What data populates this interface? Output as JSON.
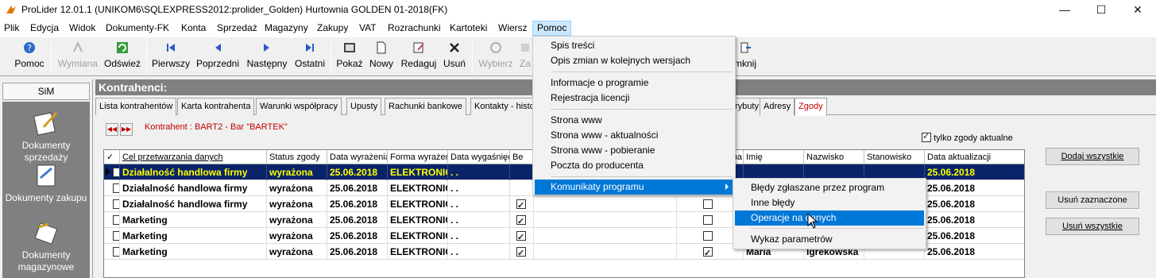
{
  "window": {
    "title": "ProLider 12.01.1  (UNIKOM6\\SQLEXPRESS2012:prolider_Golden) Hurtownia GOLDEN 01-2018(FK)",
    "minimize": "—",
    "maximize": "☐",
    "close": "✕"
  },
  "menu": [
    "Plik",
    "Edycja",
    "Widok",
    "Dokumenty-FK",
    "Konta",
    "Sprzedaż",
    "Magazyny",
    "Zakupy",
    "VAT",
    "Rozrachunki",
    "Kartoteki",
    "Wiersz",
    "Pomoc"
  ],
  "toolbar": {
    "pomoc": "Pomoc",
    "wymiana": "Wymiana",
    "odswiez": "Odśwież",
    "pierwszy": "Pierwszy",
    "poprzedni": "Poprzedni",
    "nastepny": "Następny",
    "ostatni": "Ostatni",
    "pokaz": "Pokaż",
    "nowy": "Nowy",
    "redaguj": "Redaguj",
    "usun": "Usuń",
    "wybierz": "Wybierz",
    "za": "Za",
    "zamknij": "mknij"
  },
  "left": {
    "tab": "SiM",
    "items": [
      "Dokumenty sprzedaży",
      "Dokumenty zakupu",
      "Dokumenty magazynowe"
    ]
  },
  "main": {
    "header": "Kontrahenci:",
    "tabs": [
      "Lista kontrahentów",
      "Karta kontrahenta",
      "Warunki współpracy",
      "Upusty",
      "Rachunki bankowe",
      "Kontakty - histo",
      "rybuty",
      "Adresy",
      "Zgody"
    ],
    "active_tab": "Zgody",
    "kontrahent": "Kontrahent : BART2  -  Bar \"BARTEK\"",
    "tylko_zgody": "tylko zgody aktualne",
    "columns": [
      "✓",
      "Cel przetwarzania danych",
      "Status zgody",
      "Data wyrażenia",
      "Forma wyrażeni",
      "Data wygaśnięc",
      "Be",
      "osoba",
      "Imię",
      "Nazwisko",
      "Stanowisko",
      "Data aktualizacji"
    ],
    "rows": [
      {
        "cel": "Działalność handlowa firmy",
        "status": "wyrażona",
        "data": "25.06.2018",
        "forma": "ELEKTRONIC",
        "wyg": ". .",
        "imie": "",
        "nazwisko": "",
        "akt": "25.06.2018"
      },
      {
        "cel": "Działalność handlowa firmy",
        "status": "wyrażona",
        "data": "25.06.2018",
        "forma": "ELEKTRONIC",
        "wyg": ". .",
        "imie": "",
        "nazwisko": "",
        "akt": "25.06.2018"
      },
      {
        "cel": "Działalność handlowa firmy",
        "status": "wyrażona",
        "data": "25.06.2018",
        "forma": "ELEKTRONIC",
        "wyg": ". .",
        "imie": "",
        "nazwisko": "",
        "akt": "25.06.2018"
      },
      {
        "cel": "Marketing",
        "status": "wyrażona",
        "data": "25.06.2018",
        "forma": "ELEKTRONIC",
        "wyg": ". .",
        "imie": "",
        "nazwisko": "",
        "akt": "25.06.2018"
      },
      {
        "cel": "Marketing",
        "status": "wyrażona",
        "data": "25.06.2018",
        "forma": "ELEKTRONIC",
        "wyg": ". .",
        "imie": "",
        "nazwisko": "",
        "akt": "25.06.2018"
      },
      {
        "cel": "Marketing",
        "status": "wyrażona",
        "data": "25.06.2018",
        "forma": "ELEKTRONIC",
        "wyg": ". .",
        "imie": "Maria",
        "nazwisko": "Igrekowska",
        "akt": "25.06.2018"
      }
    ],
    "buttons": {
      "dodaj": "Dodaj wszystkie",
      "usun_zazn": "Usuń zaznaczone",
      "usun_wsz": "Usuń wszystkie"
    }
  },
  "pomoc_menu": {
    "spis": "Spis treści",
    "opis": "Opis zmian w kolejnych wersjach",
    "info": "Informacje o programie",
    "rejestracja": "Rejestracja licencji",
    "www": "Strona www",
    "www_akt": "Strona www - aktualności",
    "www_pob": "Strona www - pobieranie",
    "poczta": "Poczta do producenta",
    "komunikaty": "Komunikaty programu"
  },
  "sub_menu": {
    "bledy_zgl": "Błędy zgłaszane przez program",
    "inne": "Inne błędy",
    "operacje": "Operacje na danych",
    "wykaz": "Wykaz parametrów"
  },
  "colors": {
    "selection": "#0a246a",
    "selection_text": "#ffff00",
    "menu_highlight": "#0078d7",
    "panel_gray": "#808080"
  }
}
